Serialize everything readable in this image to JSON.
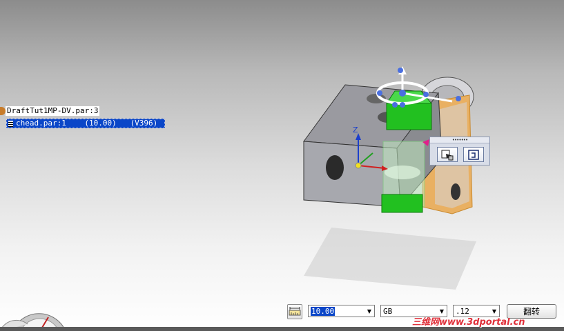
{
  "pathfinder": {
    "root_label": "DraftTut1MP-DV.par:3",
    "child_label": "chead.par:1    (10.00)   (V396)"
  },
  "viewport": {
    "axis_label_z": "Z",
    "colors": {
      "selected_part": "#22c020",
      "highlight": "#f0b040",
      "handle": "#3a5ed8",
      "part_body": "#8f9096"
    }
  },
  "quickbar": {
    "grip": "•••••••",
    "buttons": [
      "replace-part-icon",
      "assembly-relationship-icon"
    ]
  },
  "commandbar": {
    "dimension_icon": "dimension-icon",
    "value": "10.00",
    "standard": "GB",
    "precision": ".12",
    "flip_label": "翻转"
  },
  "watermark": "三维网www.3dportal.cn"
}
